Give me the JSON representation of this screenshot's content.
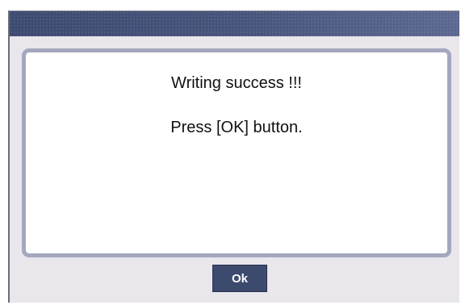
{
  "dialog": {
    "title": "",
    "messages": [
      "Writing success !!!",
      "Press [OK] button."
    ],
    "ok_label": "Ok"
  },
  "colors": {
    "titlebar": "#46537a",
    "panel_border": "#a4a8be",
    "dialog_bg": "#e9e6ec",
    "button_bg": "#3c4a6e"
  }
}
